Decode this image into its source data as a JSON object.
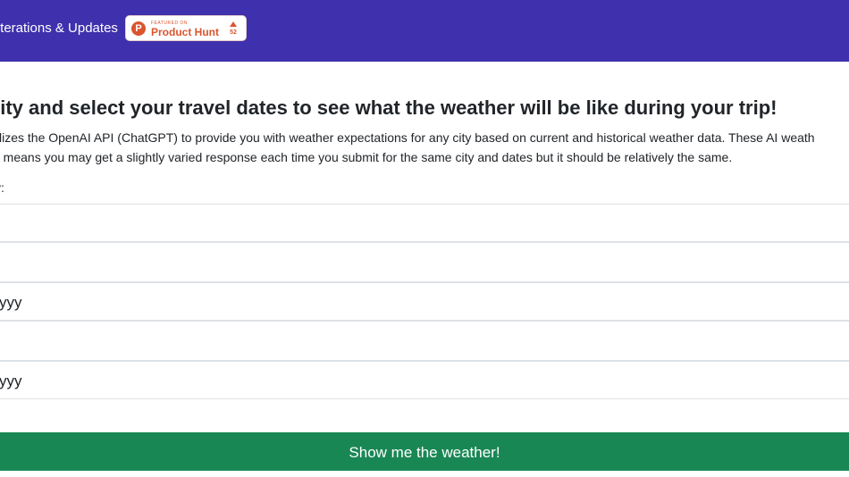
{
  "nav": {
    "link_label": "Iterations & Updates",
    "product_hunt": {
      "featured_label": "FEATURED ON",
      "name": "Product Hunt",
      "logo_letter": "P",
      "count": "52",
      "brand_color": "#da552f"
    },
    "background_color": "#3f30ad"
  },
  "main": {
    "headline": "city and select your travel dates to see what the weather will be like during your trip!",
    "description_line1": "tilizes the OpenAI API (ChatGPT) to provide you with weather expectations for any city based on current and historical weather data. These AI weath",
    "description_line2": "n means you may get a slightly varied response each time you submit for the same city and dates but it should be relatively the same.",
    "city_label": "y:",
    "start_date_value": "yyy",
    "end_date_value": "yyy",
    "submit_label": "Show me the weather!",
    "submit_color": "#198754"
  }
}
